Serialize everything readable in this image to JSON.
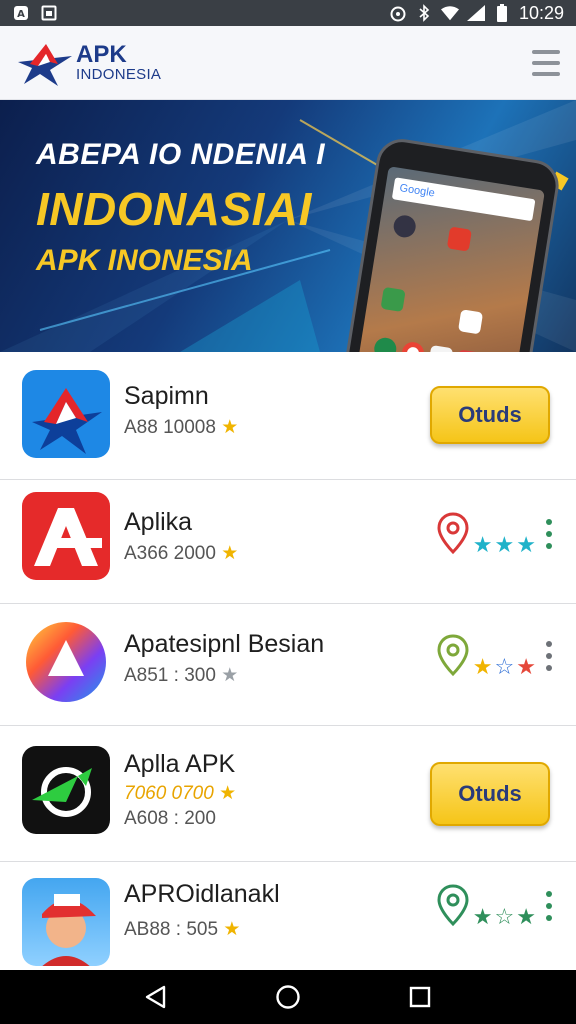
{
  "status_bar": {
    "time": "10:29",
    "icons": [
      "notification-a-icon",
      "image-icon",
      "alarm-icon",
      "bluetooth-icon",
      "wifi-icon",
      "signal-icon",
      "battery-icon"
    ]
  },
  "header": {
    "logo_line1": "APK",
    "logo_line2": "INDONESIA",
    "menu_icon": "hamburger-menu-icon"
  },
  "banner": {
    "line1": "ABEPA IO NDENIA I",
    "line2": "INDONASIAI",
    "line3": "APK INONESIA",
    "phone_search": "Google"
  },
  "apps": [
    {
      "name": "Sapimn",
      "sub": "A88 10008",
      "sub_star": "★",
      "button": "Otuds",
      "icon": "apk-indonesia-logo-icon"
    },
    {
      "name": "Aplika",
      "sub": "A366 2000",
      "sub_star": "★",
      "rating_stars": [
        "★",
        "★",
        "★"
      ],
      "icon": "red-a-icon"
    },
    {
      "name": "Apatesipnl Besian",
      "sub": "A851 : 300",
      "sub_star": "★",
      "rating_stars": [
        "★",
        "☆",
        "★"
      ],
      "icon": "rainbow-triangle-icon"
    },
    {
      "name": "Aplla APK",
      "sub_highlight": "7060 0700",
      "sub_highlight_star": "★",
      "sub": "A608 : 200",
      "button": "Otuds",
      "icon": "green-arrow-icon"
    },
    {
      "name": "APROidlanakl",
      "sub": "AB88 : 505",
      "sub_star": "★",
      "rating_stars": [
        "★",
        "☆",
        "★"
      ],
      "icon": "kid-avatar-icon"
    }
  ],
  "colors": {
    "status_bar": "#3a3f45",
    "header_bg": "#f6f7fa",
    "banner_yellow": "#f7c825",
    "button_yellow": "#f5c518",
    "star_yellow": "#f0b400",
    "star_teal": "#1fb2c9",
    "nav_bar": "#000000"
  },
  "nav": {
    "back_icon": "back-triangle-icon",
    "home_icon": "home-circle-icon",
    "recents_icon": "recents-square-icon"
  }
}
